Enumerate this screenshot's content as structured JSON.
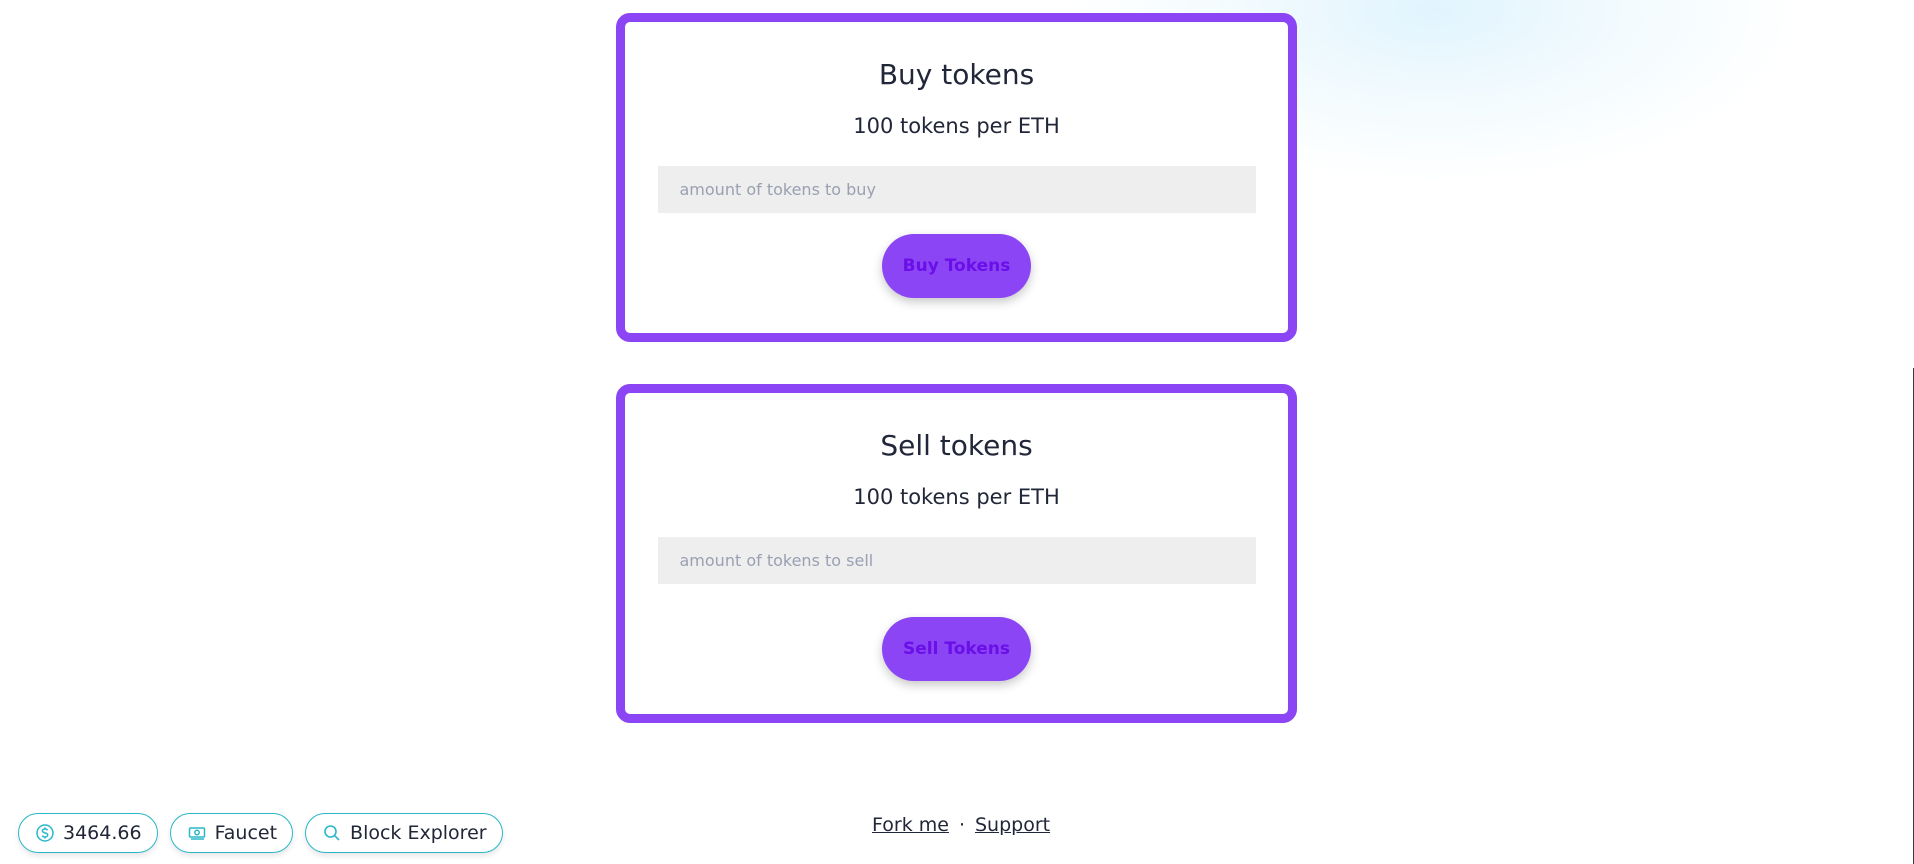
{
  "buy": {
    "title": "Buy tokens",
    "rate": "100 tokens per ETH",
    "input_placeholder": "amount of tokens to buy",
    "button_label": "Buy Tokens"
  },
  "sell": {
    "title": "Sell tokens",
    "rate": "100 tokens per ETH",
    "input_placeholder": "amount of tokens to sell",
    "button_label": "Sell Tokens"
  },
  "footer": {
    "balance": "3464.66",
    "faucet_label": "Faucet",
    "block_explorer_label": "Block Explorer",
    "fork_me_label": "Fork me",
    "separator": "·",
    "support_label": "Support"
  },
  "icons": {
    "balance": "dollar-circle-icon",
    "faucet": "banknotes-icon",
    "block_explorer": "search-icon"
  },
  "colors": {
    "card_border": "#8b45f5",
    "button_bg": "#8b45f5",
    "button_text": "#6a0fe8",
    "pill_border": "#2ab7c9",
    "input_bg": "#eeeeee",
    "text": "#212638"
  }
}
